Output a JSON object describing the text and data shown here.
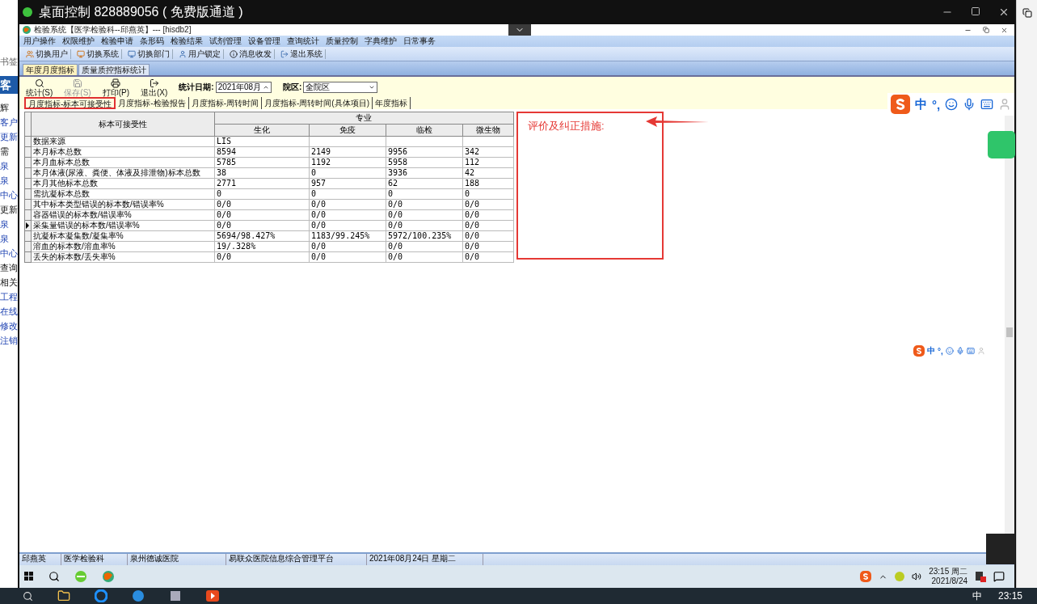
{
  "background_page": {
    "items": [
      {
        "text": "书签",
        "kind": "muted"
      },
      {
        "text": "客",
        "kind": "heading"
      },
      {
        "text": "辉",
        "kind": "text"
      },
      {
        "text": "客户",
        "kind": "link"
      },
      {
        "text": "更新",
        "kind": "link"
      },
      {
        "text": "需",
        "kind": "text"
      },
      {
        "text": "泉",
        "kind": "link"
      },
      {
        "text": "泉",
        "kind": "link"
      },
      {
        "text": "中心",
        "kind": "link"
      },
      {
        "text": "更新",
        "kind": "text"
      },
      {
        "text": "泉",
        "kind": "link"
      },
      {
        "text": "泉",
        "kind": "link"
      },
      {
        "text": "中心",
        "kind": "link"
      },
      {
        "text": "查询",
        "kind": "text"
      },
      {
        "text": "相关",
        "kind": "text"
      },
      {
        "text": "工程",
        "kind": "link"
      },
      {
        "text": "在线",
        "kind": "link"
      },
      {
        "text": "修改",
        "kind": "link"
      },
      {
        "text": "注销",
        "kind": "link"
      }
    ]
  },
  "remote_window": {
    "title": "桌面控制 828889056 ( 免费版通道 )",
    "connected": true
  },
  "app": {
    "title": "检验系统【医学检验科--邱燕英】--- [hisdb2]",
    "menu": [
      "用户操作",
      "权限维护",
      "检验申请",
      "条形码",
      "检验结果",
      "试剂管理",
      "设备管理",
      "查询统计",
      "质量控制",
      "字典维护",
      "日常事务"
    ],
    "toolbar": [
      {
        "label": "切换用户",
        "kind": "user"
      },
      {
        "label": "切换系统",
        "kind": "system"
      },
      {
        "label": "切换部门",
        "kind": "dept"
      },
      {
        "label": "用户锁定",
        "kind": "lock"
      },
      {
        "label": "消息收发",
        "kind": "info"
      },
      {
        "label": "退出系统",
        "kind": "exit"
      }
    ],
    "tabs": [
      {
        "label": "年度月度指标",
        "selected": true
      },
      {
        "label": "质量质控指标统计",
        "selected": false
      }
    ],
    "actions": [
      {
        "label": "统计(S)",
        "kind": "search",
        "disabled": false
      },
      {
        "label": "保存(S)",
        "kind": "save",
        "disabled": true
      },
      {
        "label": "打印(P)",
        "kind": "print",
        "disabled": false
      },
      {
        "label": "退出(X)",
        "kind": "exit",
        "disabled": false
      }
    ],
    "date_label": "统计日期:",
    "date_value": "2021年08月",
    "campus_label": "院区:",
    "campus_value": "全院区",
    "subtabs": [
      {
        "label": "月度指标-标本可接受性",
        "selected": true
      },
      {
        "label": "月度指标-检验报告",
        "selected": false
      },
      {
        "label": "月度指标-周转时间",
        "selected": false
      },
      {
        "label": "月度指标-周转时间(具体项目)",
        "selected": false
      },
      {
        "label": "年度指标",
        "selected": false
      }
    ],
    "table": {
      "corner": "标本可接受性",
      "group": "专业",
      "columns": [
        "生化",
        "免疫",
        "临检",
        "微生物"
      ],
      "rows": [
        {
          "label": "数据来源",
          "cells": [
            "LIS",
            "",
            "",
            ""
          ],
          "selected": false
        },
        {
          "label": "本月标本总数",
          "cells": [
            "8594",
            "2149",
            "9956",
            "342"
          ],
          "selected": false
        },
        {
          "label": "本月血标本总数",
          "cells": [
            "5785",
            "1192",
            "5958",
            "112"
          ],
          "selected": false
        },
        {
          "label": "本月体液(尿液、粪便、体液及排泄物)标本总数",
          "cells": [
            "38",
            "0",
            "3936",
            "42"
          ],
          "selected": false
        },
        {
          "label": "本月其他标本总数",
          "cells": [
            "2771",
            "957",
            "62",
            "188"
          ],
          "selected": false
        },
        {
          "label": "需抗凝标本总数",
          "cells": [
            "0",
            "0",
            "0",
            "0"
          ],
          "selected": false
        },
        {
          "label": "其中标本类型错误的标本数/错误率%",
          "cells": [
            "0/0",
            "0/0",
            "0/0",
            "0/0"
          ],
          "selected": false
        },
        {
          "label": "容器错误的标本数/错误率%",
          "cells": [
            "0/0",
            "0/0",
            "0/0",
            "0/0"
          ],
          "selected": false
        },
        {
          "label": "采集量错误的标本数/错误率%",
          "cells": [
            "0/0",
            "0/0",
            "0/0",
            "0/0"
          ],
          "selected": true
        },
        {
          "label": "抗凝标本凝集数/凝集率%",
          "cells": [
            "5694/98.427%",
            "1183/99.245%",
            "5972/100.235%",
            "0/0"
          ],
          "selected": false
        },
        {
          "label": "溶血的标本数/溶血率%",
          "cells": [
            "19/.328%",
            "0/0",
            "0/0",
            "0/0"
          ],
          "selected": false
        },
        {
          "label": "丢失的标本数/丢失率%",
          "cells": [
            "0/0",
            "0/0",
            "0/0",
            "0/0"
          ],
          "selected": false
        }
      ]
    },
    "annotation": "评价及纠正措施:",
    "status_bar": [
      "邱燕英",
      "医学检验科",
      "泉州德诚医院",
      "易联众医院信息综合管理平台",
      "2021年08月24日 星期二"
    ]
  },
  "remote_taskbar": {
    "time": "23:15 周二",
    "date": "2021/8/24"
  },
  "ime_toolbars": [
    {
      "mode": "中",
      "punct": "°,"
    },
    {
      "mode": "中",
      "punct": "°,"
    }
  ],
  "host_taskbar": {
    "ime": "中",
    "time": "23:15"
  }
}
